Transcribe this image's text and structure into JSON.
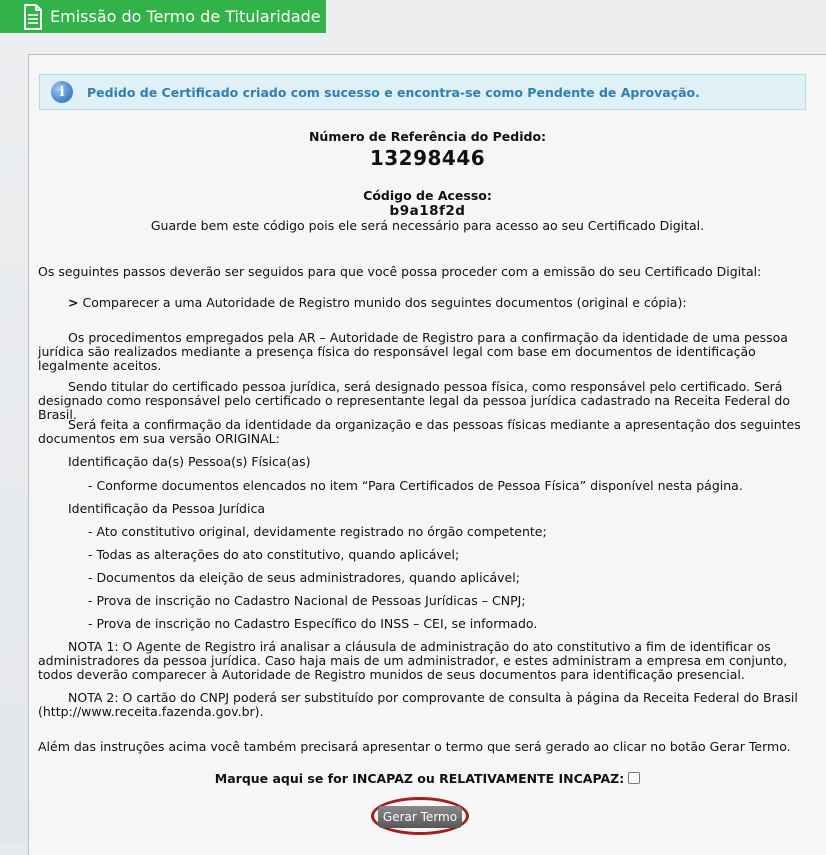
{
  "header": {
    "title": "Emissão do Termo de Titularidade",
    "icon": "document-icon"
  },
  "alert": {
    "icon": "info-icon",
    "message": "Pedido de Certificado criado com sucesso e encontra-se como Pendente de Aprovação."
  },
  "reference": {
    "label": "Número de Referência do Pedido:",
    "value": "13298446"
  },
  "access": {
    "label": "Código de Acesso:",
    "value": "b9a18f2d",
    "note": "Guarde bem este código pois ele será necessário para acesso ao seu Certificado Digital."
  },
  "instructions": {
    "intro": "Os seguintes passos deverão ser seguidos para que você possa proceder com a emissão do seu Certificado Digital:",
    "step_arrow": ">",
    "step": "Comparecer a uma Autoridade de Registro munido dos seguintes documentos (original e cópia):",
    "p1": "Os procedimentos empregados pela AR – Autoridade de Registro para a confirmação da identidade de uma pessoa jurídica são realizados mediante a presença física do responsável legal com base em documentos de identificação legalmente aceitos.",
    "p2": "Sendo titular do certificado pessoa jurídica, será designado pessoa física, como responsável pelo certificado. Será designado como responsável pelo certificado o representante legal da pessoa jurídica cadastrado na Receita Federal do Brasil.",
    "p3": "Será feita a confirmação da identidade da organização e das pessoas físicas mediante a apresentação dos seguintes documentos em sua versão ORIGINAL:",
    "pf_heading": "Identificação da(s) Pessoa(s) Física(as)",
    "pf_items": [
      "- Conforme documentos elencados no item “Para Certificados de Pessoa Física” disponível nesta página."
    ],
    "pj_heading": "Identificação da Pessoa Jurídica",
    "pj_items": [
      "- Ato constitutivo original, devidamente registrado no órgão competente;",
      "- Todas as alterações do ato constitutivo, quando aplicável;",
      "- Documentos da eleição de seus administradores, quando aplicável;",
      "- Prova de inscrição no Cadastro Nacional de Pessoas Jurídicas – CNPJ;",
      "- Prova de inscrição no Cadastro Específico do INSS – CEI, se informado."
    ],
    "nota1": "NOTA 1: O Agente de Registro irá analisar a cláusula de administração do ato constitutivo a fim de identificar os administradores da pessoa jurídica. Caso haja mais de um administrador, e estes administram a empresa em conjunto, todos deverão comparecer à Autoridade de Registro munidos de seus documentos para identificação presencial.",
    "nota2": "NOTA 2: O cartão do CNPJ poderá ser substituído por comprovante de consulta à página da Receita Federal do Brasil (http://www.receita.fazenda.gov.br).",
    "final": "Além das instruções acima você também precisará apresentar o termo que será gerado ao clicar no botão Gerar Termo."
  },
  "incapaz": {
    "label": "Marque aqui se for INCAPAZ ou RELATIVAMENTE INCAPAZ:",
    "checked": false
  },
  "button": {
    "label": "Gerar Termo"
  },
  "colors": {
    "header_green": "#32b34a",
    "alert_text": "#2f7fb0",
    "alert_bg": "#dff0f6",
    "button_ring": "#a2201c"
  }
}
